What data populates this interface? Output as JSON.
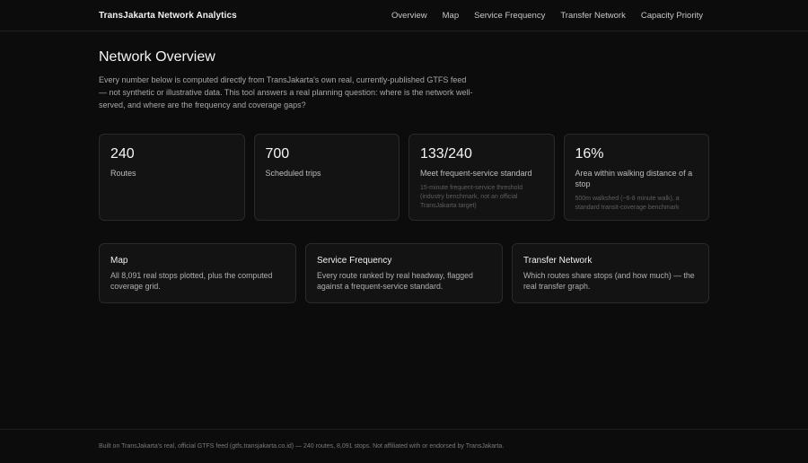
{
  "header": {
    "brand": "TransJakarta Network Analytics",
    "nav": [
      "Overview",
      "Map",
      "Service Frequency",
      "Transfer Network",
      "Capacity Priority"
    ]
  },
  "main": {
    "title": "Network Overview",
    "intro": "Every number below is computed directly from TransJakarta's own real, currently-published GTFS feed — not synthetic or illustrative data. This tool answers a real planning question: where is the network well-served, and where are the frequency and coverage gaps?",
    "stats": [
      {
        "value": "240",
        "label": "Routes",
        "note": ""
      },
      {
        "value": "700",
        "label": "Scheduled trips",
        "note": ""
      },
      {
        "value": "133/240",
        "label": "Meet frequent-service standard",
        "note": "15-minute frequent-service threshold (industry benchmark, not an official TransJakarta target)"
      },
      {
        "value": "16%",
        "label": "Area within walking distance of a stop",
        "note": "500m walkshed (~6-8 minute walk), a standard transit-coverage benchmark"
      }
    ],
    "cards": [
      {
        "title": "Map",
        "desc": "All 8,091 real stops plotted, plus the computed coverage grid."
      },
      {
        "title": "Service Frequency",
        "desc": "Every route ranked by real headway, flagged against a frequent-service standard."
      },
      {
        "title": "Transfer Network",
        "desc": "Which routes share stops (and how much) — the real transfer graph."
      }
    ]
  },
  "footer": {
    "text": "Built on TransJakarta's real, official GTFS feed (gtfs.transjakarta.co.id) — 240 routes, 8,091 stops. Not affiliated with or endorsed by TransJakarta."
  }
}
